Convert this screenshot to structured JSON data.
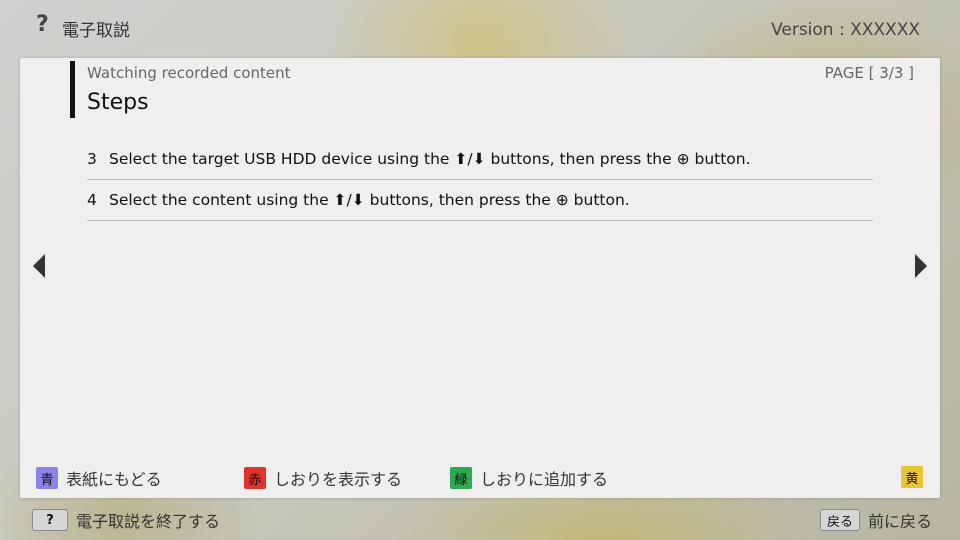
{
  "header": {
    "help_glyph": "?",
    "title": "電子取説",
    "version": "Version : XXXXXX"
  },
  "panel": {
    "section": "Watching recorded content",
    "page_indicator": "PAGE [ 3/3 ]",
    "heading": "Steps",
    "steps": [
      {
        "number": "3",
        "text": "Select the target USB HDD device using the ⬆/⬇ buttons, then press the ⊕ button."
      },
      {
        "number": "4",
        "text": "Select the content using the ⬆/⬇ buttons, then press the ⊕ button."
      }
    ]
  },
  "color_buttons": [
    {
      "key": "青",
      "label": "表紙にもどる",
      "color": "#8a84ea"
    },
    {
      "key": "赤",
      "label": "しおりを表示する",
      "color": "#e0332b"
    },
    {
      "key": "緑",
      "label": "しおりに追加する",
      "color": "#2fa84f"
    },
    {
      "key": "黄",
      "label": "",
      "color": "#e8c532"
    }
  ],
  "footer": {
    "exit_key": "?",
    "exit_label": "電子取説を終了する",
    "back_key": "戻る",
    "back_label": "前に戻る"
  }
}
